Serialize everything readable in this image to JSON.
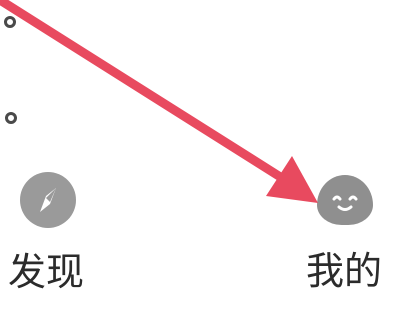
{
  "bottom_nav": {
    "items": [
      {
        "label": "发现",
        "icon": "compass-icon"
      },
      {
        "label": "我的",
        "icon": "smiley-face-icon"
      }
    ]
  },
  "annotation": {
    "arrow_color": "#e84a5f",
    "description_icon": "red-arrow-icon"
  },
  "colors": {
    "icon_gray": "#9a9a9a",
    "text_dark": "#2b2b2b",
    "background": "#ffffff"
  }
}
